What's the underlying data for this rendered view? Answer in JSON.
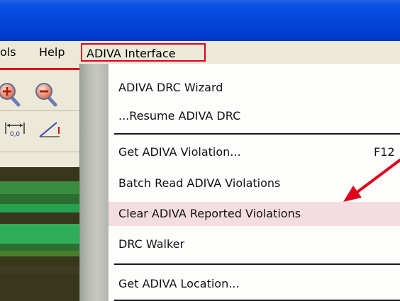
{
  "menubar": {
    "tools_partial": "ols",
    "help_label": "Help",
    "adiva_label": "ADIVA Interface"
  },
  "dropdown": {
    "items": [
      {
        "label": "ADIVA DRC Wizard",
        "shortcut": ""
      },
      {
        "label": "...Resume ADIVA DRC",
        "shortcut": ""
      },
      {
        "label": "Get ADIVA Violation...",
        "shortcut": "F12"
      },
      {
        "label": "Batch Read ADIVA Violations",
        "shortcut": ""
      },
      {
        "label": "Clear ADIVA Reported Violations",
        "shortcut": "",
        "highlighted": true
      },
      {
        "label": "DRC Walker",
        "shortcut": ""
      },
      {
        "label": "Get ADIVA Location...",
        "shortcut": ""
      }
    ]
  },
  "toolbar": {
    "icons": [
      "zoom-in-icon",
      "zoom-out-icon",
      "dimension-icon",
      "angle-icon"
    ],
    "dimension_text": "0,0"
  },
  "colors": {
    "titlebar": "#0245d7",
    "highlight_box": "#e0001b",
    "menu_highlight": "#f4dde1",
    "annotation_arrow": "#e0001b",
    "canvas_trace": "#2fae5a"
  }
}
